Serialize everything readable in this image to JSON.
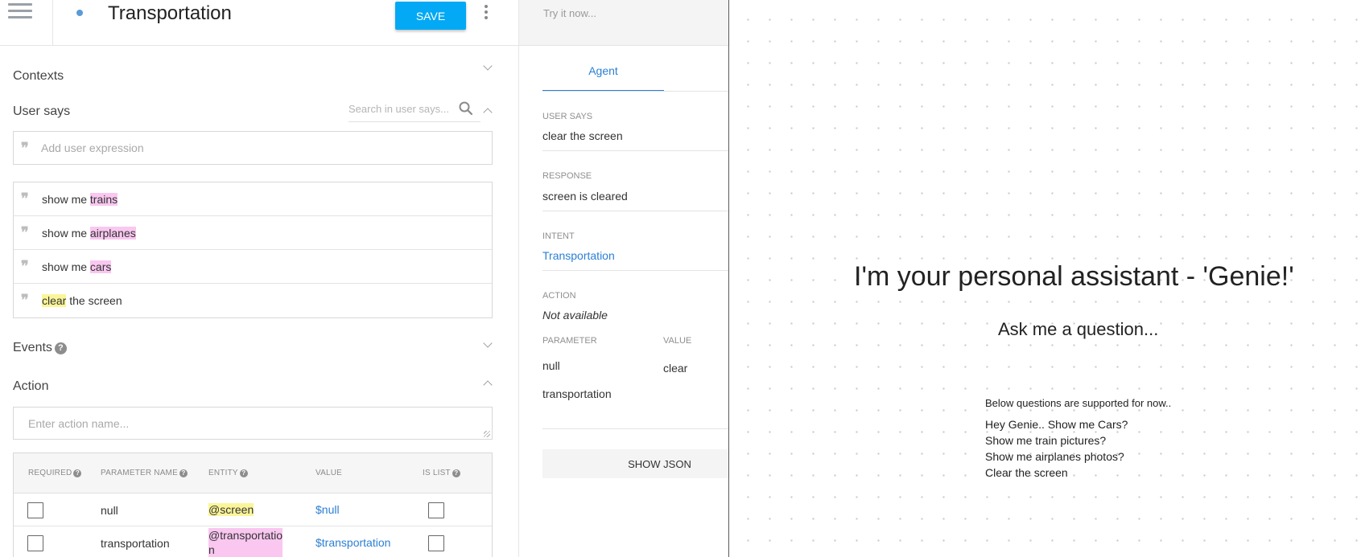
{
  "editor": {
    "intent_title": "Transportation",
    "save_label": "SAVE",
    "sections": {
      "contexts": "Contexts",
      "user_says": "User says",
      "events": "Events",
      "action": "Action"
    },
    "search_placeholder": "Search in user says...",
    "add_expression_placeholder": "Add user expression",
    "expressions": [
      {
        "plain_before": "show me ",
        "highlight": "trains",
        "plain_after": "",
        "color": "#f9c7f0"
      },
      {
        "plain_before": "show me ",
        "highlight": "airplanes",
        "plain_after": "",
        "color": "#f9c7f0"
      },
      {
        "plain_before": "show me ",
        "highlight": "cars",
        "plain_after": "",
        "color": "#f9c7f0"
      },
      {
        "plain_before": "",
        "highlight": "clear",
        "plain_after": " the screen",
        "color": "#fbf59a"
      }
    ],
    "action_placeholder": "Enter action name...",
    "param_headers": {
      "required": "REQUIRED",
      "name": "PARAMETER NAME",
      "entity": "ENTITY",
      "value": "VALUE",
      "is_list": "IS LIST"
    },
    "params": [
      {
        "name": "null",
        "entity": "@screen",
        "value": "$null",
        "entity_color": "#fbf59a"
      },
      {
        "name": "transportation",
        "entity_line1": "@transportatio",
        "entity_line2": "n",
        "value": "$transportation",
        "entity_color": "#f9c7f0"
      }
    ],
    "help_glyph": "?"
  },
  "console": {
    "try_placeholder": "Try it now...",
    "tab_agent": "Agent",
    "user_says_label": "USER SAYS",
    "user_says_value": "clear the screen",
    "response_label": "RESPONSE",
    "response_value": "screen is cleared",
    "intent_label": "INTENT",
    "intent_value": "Transportation",
    "action_label": "ACTION",
    "action_value": "Not available",
    "parameter_label": "PARAMETER",
    "value_label": "VALUE",
    "params": [
      {
        "name": "null",
        "value": "clear"
      },
      {
        "name": "transportation",
        "value": ""
      }
    ],
    "show_json_label": "SHOW JSON"
  },
  "preview": {
    "title": "I'm your personal assistant - 'Genie!'",
    "subtitle": "Ask me a question...",
    "note": "Below questions are supported for now..",
    "questions": [
      "Hey Genie.. Show me Cars?",
      "Show me train pictures?",
      "Show me airplanes photos?",
      "Clear the screen"
    ]
  },
  "colors": {
    "accent": "#03a9f4",
    "link": "#2b7fd4",
    "highlight_pink": "#f9c7f0",
    "highlight_yellow": "#fbf59a"
  },
  "icons": [
    "menu-icon",
    "search-icon",
    "quote-icon",
    "help-icon",
    "more-vertical-icon",
    "chevron-down-icon",
    "chevron-up-icon"
  ]
}
